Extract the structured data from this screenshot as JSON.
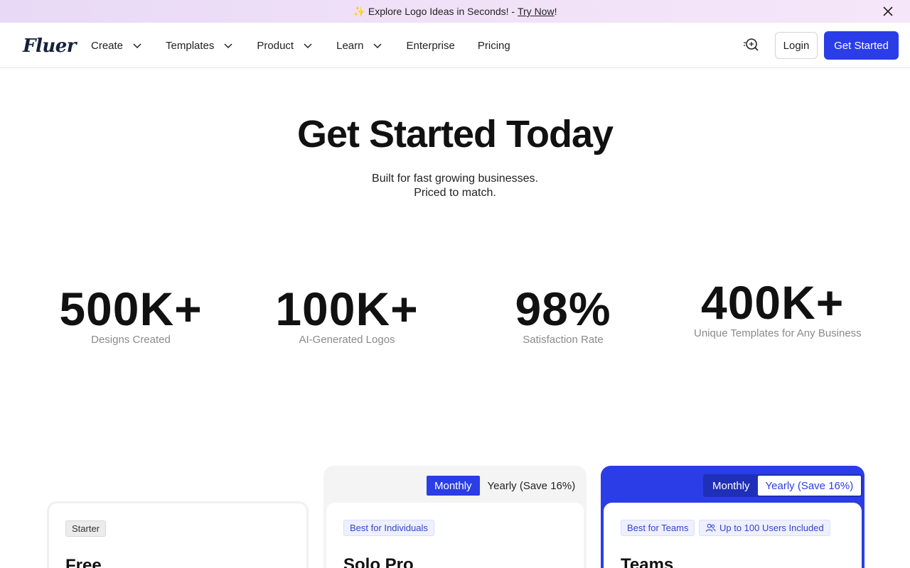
{
  "announcement": {
    "prefix": "✨ Explore Logo Ideas in Seconds! - ",
    "link": "Try Now",
    "suffix": "!"
  },
  "nav": {
    "logo": "Fluer",
    "items": [
      {
        "label": "Create"
      },
      {
        "label": "Templates"
      },
      {
        "label": "Product"
      },
      {
        "label": "Learn"
      },
      {
        "label": "Enterprise"
      },
      {
        "label": "Pricing"
      }
    ],
    "login": "Login",
    "get_started": "Get Started"
  },
  "hero": {
    "title": "Get Started Today",
    "subtitle_line1": "Built for fast growing businesses.",
    "subtitle_line2": "Priced to match."
  },
  "stats": [
    {
      "value": "500K+",
      "label": "Designs Created"
    },
    {
      "value": "100K+",
      "label": "AI-Generated Logos"
    },
    {
      "value": "98%",
      "label": "Satisfaction Rate"
    },
    {
      "value": "400K+",
      "label": "Unique Templates for Any Business"
    }
  ],
  "pricing": {
    "starter": {
      "badge": "Starter",
      "title": "Free"
    },
    "solo": {
      "toggle_monthly": "Monthly",
      "toggle_yearly": "Yearly (Save 16%)",
      "badge": "Best for Individuals",
      "title": "Solo Pro"
    },
    "teams": {
      "toggle_monthly": "Monthly",
      "toggle_yearly": "Yearly (Save 16%)",
      "badge": "Best for Teams",
      "badge2": "Up to 100 Users Included",
      "title": "Teams"
    }
  },
  "colors": {
    "accent": "#2b3de6",
    "announcement_bg": "#f1e1f8"
  }
}
